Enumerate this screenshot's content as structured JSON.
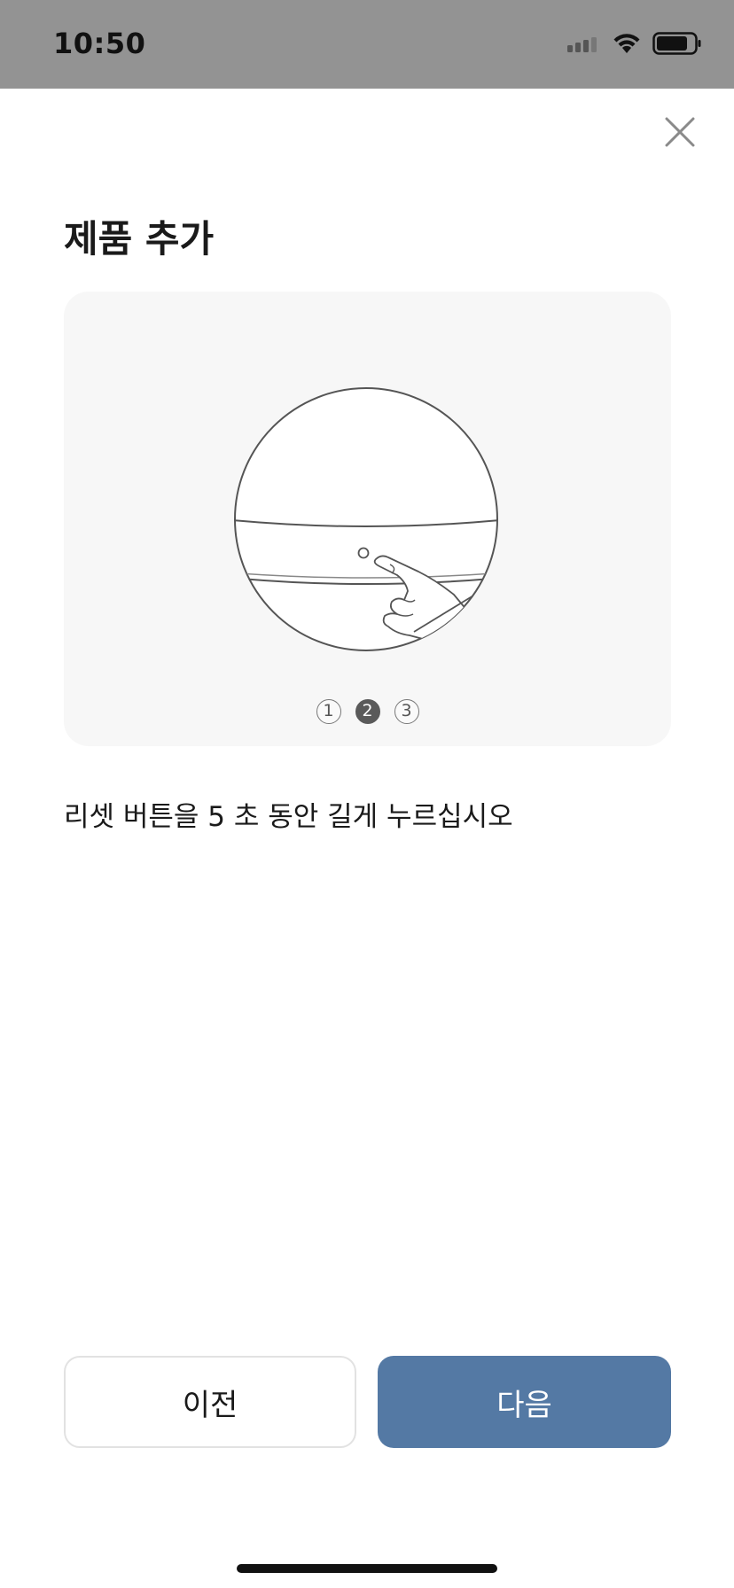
{
  "status_bar": {
    "time": "10:50",
    "icons": [
      "signal-icon",
      "wifi-icon",
      "battery-icon"
    ]
  },
  "header": {
    "close_icon": "close-icon"
  },
  "title": "제품 추가",
  "illustration": {
    "icon": "device-reset-illustration",
    "steps": [
      "1",
      "2",
      "3"
    ],
    "active_step": 2
  },
  "instruction": "리셋 버튼을 5 초 동안 길게 누르십시오",
  "buttons": {
    "prev_label": "이전",
    "next_label": "다음"
  },
  "colors": {
    "status_bar_bg": "#939393",
    "card_bg": "#f7f7f7",
    "primary_button": "#5479a4",
    "active_step": "#5a5a5a"
  }
}
